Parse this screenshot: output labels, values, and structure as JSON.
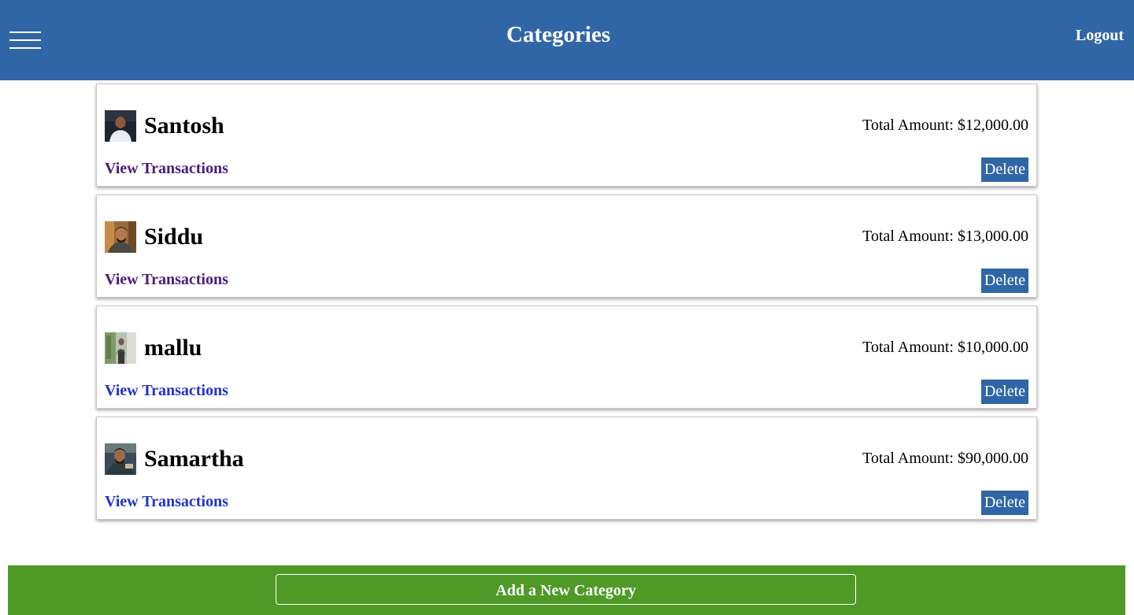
{
  "header": {
    "title": "Categories",
    "logout_label": "Logout",
    "background_color": "#3166a6",
    "menu_icon": "hamburger-menu-icon"
  },
  "categories": [
    {
      "name": "Santosh",
      "total_label": "Total Amount: $12,000.00",
      "view_label": "View Transactions",
      "delete_label": "Delete",
      "link_state": "visited"
    },
    {
      "name": "Siddu",
      "total_label": "Total Amount: $13,000.00",
      "view_label": "View Transactions",
      "delete_label": "Delete",
      "link_state": "visited"
    },
    {
      "name": "mallu",
      "total_label": "Total Amount: $10,000.00",
      "view_label": "View Transactions",
      "delete_label": "Delete",
      "link_state": "unvisited"
    },
    {
      "name": "Samartha",
      "total_label": "Total Amount: $90,000.00",
      "view_label": "View Transactions",
      "delete_label": "Delete",
      "link_state": "unvisited"
    }
  ],
  "footer": {
    "add_label": "Add a New Category",
    "background_color": "#4f9a26"
  }
}
